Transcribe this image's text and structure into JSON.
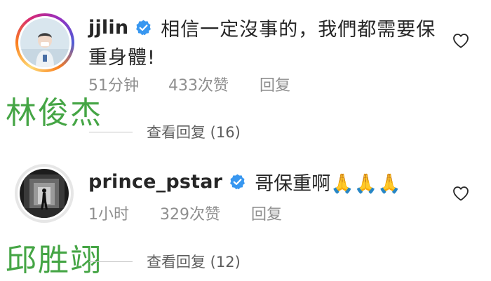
{
  "comments": [
    {
      "username": "jjlin",
      "text_line1": "相信一定沒事的，我們都需要保",
      "text_line2": "重身體!",
      "time": "51分钟",
      "likes": "433次赞",
      "reply_label": "回复",
      "view_replies": "查看回复 (16)",
      "overlay_name": "林俊杰"
    },
    {
      "username": "prince_pstar",
      "text": "哥保重啊🙏🙏🙏",
      "time": "1小时",
      "likes": "329次赞",
      "reply_label": "回复",
      "view_replies": "查看回复 (12)",
      "overlay_name": "邱胜翊"
    }
  ],
  "icons": {
    "verified": "verified-badge-icon",
    "like": "heart-outline-icon"
  },
  "colors": {
    "verified_blue": "#3897f0",
    "overlay_green": "#45a545",
    "meta_gray": "#8e8e8e"
  }
}
